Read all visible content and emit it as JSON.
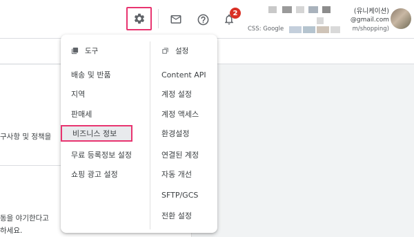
{
  "header": {
    "notification_count": "2",
    "account_name": "(유니케이션)",
    "account_email": "@gmail.com",
    "css_label": "CSS: Google",
    "css_url": "m/shopping)"
  },
  "background": {
    "text1": "구사항 및 정책을",
    "text2": "동을 야기한다고",
    "text3": "하세요."
  },
  "menu": {
    "tools_header": "도구",
    "settings_header": "설정",
    "tools": [
      "배송 및 반품",
      "지역",
      "판매세",
      "비즈니스 정보",
      "무료 등록정보 설정",
      "쇼핑 광고 설정"
    ],
    "settings": [
      "Content API",
      "계정 설정",
      "계정 액세스",
      "환경설정",
      "연결된 계정",
      "자동 개선",
      "SFTP/GCS",
      "전환 설정"
    ],
    "selected_tool": "비즈니스 정보"
  },
  "colors": {
    "highlight": "#e8336f",
    "badge": "#d93025"
  },
  "icons": [
    "gear-icon",
    "mail-icon",
    "help-icon",
    "bell-icon",
    "tools-icon",
    "settings-icon"
  ]
}
